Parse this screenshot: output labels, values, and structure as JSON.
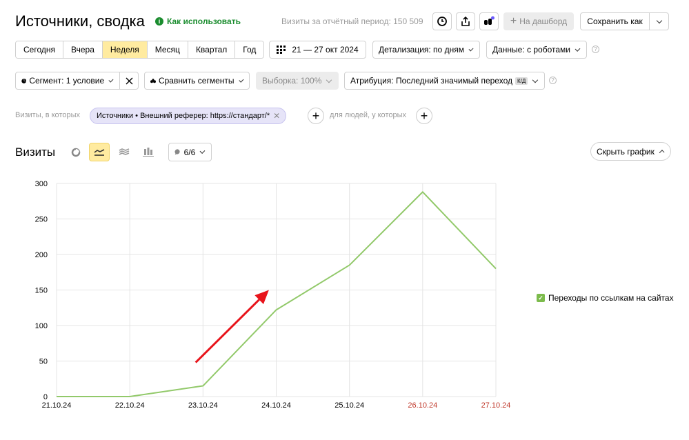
{
  "header": {
    "title": "Источники, сводка",
    "howto_label": "Как использовать",
    "visits_total": "Визиты за отчётный период: 150 509",
    "to_dashboard_label": "На дашборд",
    "save_as_label": "Сохранить как"
  },
  "periods": [
    {
      "label": "Сегодня",
      "active": false
    },
    {
      "label": "Вчера",
      "active": false
    },
    {
      "label": "Неделя",
      "active": true
    },
    {
      "label": "Месяц",
      "active": false
    },
    {
      "label": "Квартал",
      "active": false
    },
    {
      "label": "Год",
      "active": false
    }
  ],
  "toolbar": {
    "date_range": "21 — 27 окт 2024",
    "detail_label": "Детализация: по дням",
    "data_label": "Данные: с роботами",
    "segment_label": "Сегмент: 1 условие",
    "compare_label": "Сравнить сегменты",
    "sample_label": "Выборка: 100%",
    "attribution_label": "Атрибуция: Последний значимый переход",
    "attribution_badge": "К/Д"
  },
  "filter": {
    "prefix": "Визиты, в которых",
    "chip_label": "Источники • Внешний реферер: https://стандарт/*",
    "people_label": "для людей, у которых"
  },
  "chart_header": {
    "title": "Визиты",
    "series_count": "6/6",
    "hide_chart_label": "Скрыть график"
  },
  "colors": {
    "accent": "#ffeba0",
    "series": "#92c96a",
    "weekend_label": "#c0392b",
    "arrow": "#e8141b"
  },
  "chart_data": {
    "type": "line",
    "categories": [
      "21.10.24",
      "22.10.24",
      "23.10.24",
      "24.10.24",
      "25.10.24",
      "26.10.24",
      "27.10.24"
    ],
    "weekend": [
      false,
      false,
      false,
      false,
      false,
      true,
      true
    ],
    "series": [
      {
        "name": "Переходы по ссылкам на сайтах",
        "values": [
          0,
          0,
          15,
          122,
          185,
          288,
          180
        ]
      }
    ],
    "yticks": [
      0,
      50,
      100,
      150,
      200,
      250,
      300
    ],
    "ylim": [
      0,
      300
    ],
    "grid": true,
    "legend": "right",
    "annotation": {
      "type": "arrow",
      "from": [
        1.9,
        48
      ],
      "to": [
        2.9,
        150
      ]
    }
  }
}
